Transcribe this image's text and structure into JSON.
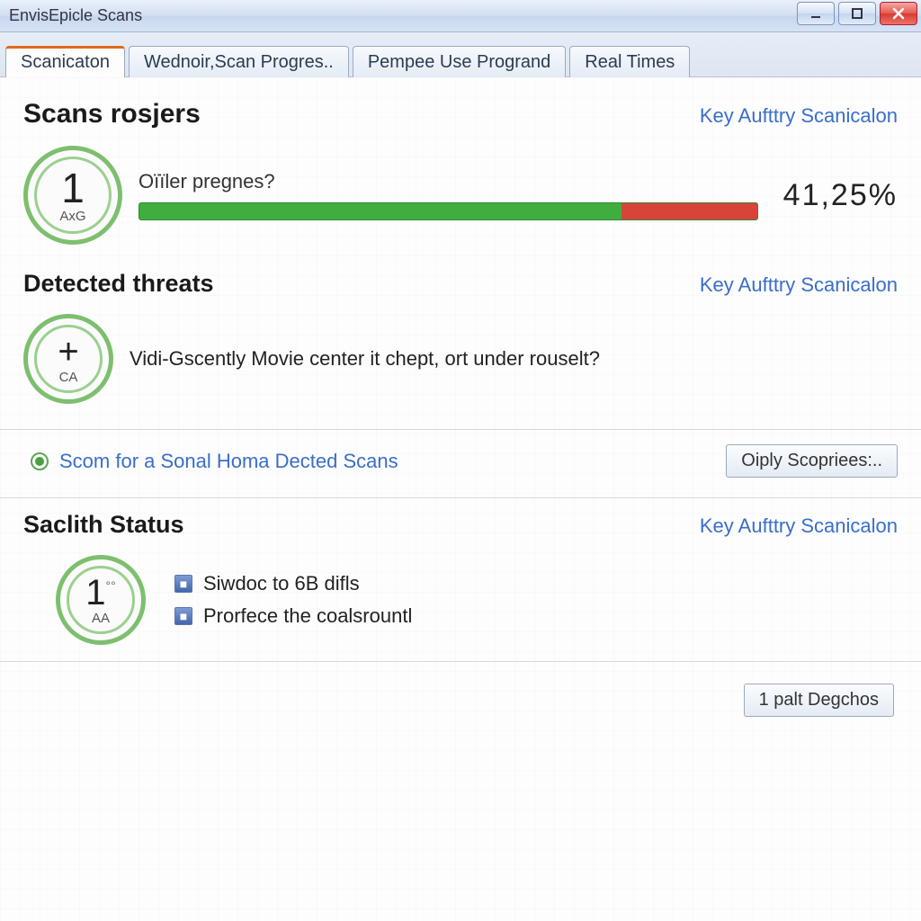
{
  "window": {
    "title": "EnvisEpicle Scans"
  },
  "tabs": [
    {
      "label": "Scanicaton"
    },
    {
      "label": "Wednoir,Scan Progres.."
    },
    {
      "label": "Pempee Use Progrand"
    },
    {
      "label": "Real Times"
    }
  ],
  "links": {
    "key_auth": "Key Aufttry Scanicalon"
  },
  "scan_progress": {
    "title": "Scans rosjers",
    "badge_num": "1",
    "badge_sub": "AxG",
    "label": "Oïïler pregnes?",
    "percent_text": "41,25%"
  },
  "threats": {
    "title": "Detected threats",
    "badge_num": "+",
    "badge_sub": "CA",
    "text": "Vidi-Gscently Movie center it chept, ort under rouselt?"
  },
  "radio": {
    "text": "Scom for a Sonal Homa Dected Scans",
    "button": "Oiply Scopriees:.."
  },
  "status": {
    "title": "Saclith Status",
    "badge_num": "1",
    "badge_sup": "°°",
    "badge_sub": "AA",
    "items": [
      {
        "label": "Siwdoc to 6B difls"
      },
      {
        "label": "Prorfece the coalsrountl"
      }
    ]
  },
  "footer": {
    "button": "1 palt Degchos"
  }
}
